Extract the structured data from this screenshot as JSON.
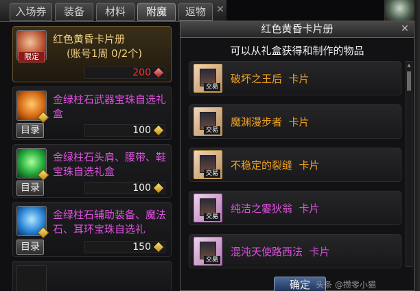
{
  "tabs": [
    {
      "label": "入场券",
      "active": false
    },
    {
      "label": "装备",
      "active": false
    },
    {
      "label": "材料",
      "active": false
    },
    {
      "label": "附魔",
      "active": true
    },
    {
      "label": "返物",
      "active": false
    }
  ],
  "items": [
    {
      "name": "红色黄昏卡片册",
      "sub": "(账号1周 0/2个)",
      "badge": "限定",
      "price": "200",
      "catalog": ""
    },
    {
      "name": "金绿柱石武器宝珠自选礼盒",
      "sub": "",
      "badge": "",
      "price": "100",
      "catalog": "目录"
    },
    {
      "name": "金绿柱石头肩、腰带、鞋宝珠自选礼盒",
      "sub": "",
      "badge": "",
      "price": "100",
      "catalog": "目录"
    },
    {
      "name": "金绿柱石辅助装备、魔法石、耳环宝珠自选礼",
      "sub": "",
      "badge": "",
      "price": "150",
      "catalog": "目录"
    }
  ],
  "popup": {
    "title": "红色黄昏卡片册",
    "subtitle": "可以从礼盒获得和制作的物品",
    "trade_label": "交易",
    "cards": [
      {
        "name": "破坏之王后  卡片"
      },
      {
        "name": "魔渊漫步者  卡片"
      },
      {
        "name": "不稳定的裂缝  卡片"
      },
      {
        "name": "纯洁之霎狄翁  卡片"
      },
      {
        "name": "混沌天使路西法  卡片"
      }
    ],
    "ok_label": "确定"
  },
  "watermark": "头条 @攒零小猫",
  "colors": {
    "pink": "#e050e0",
    "gold": "#f0a020",
    "price_red": "#ff3030"
  }
}
